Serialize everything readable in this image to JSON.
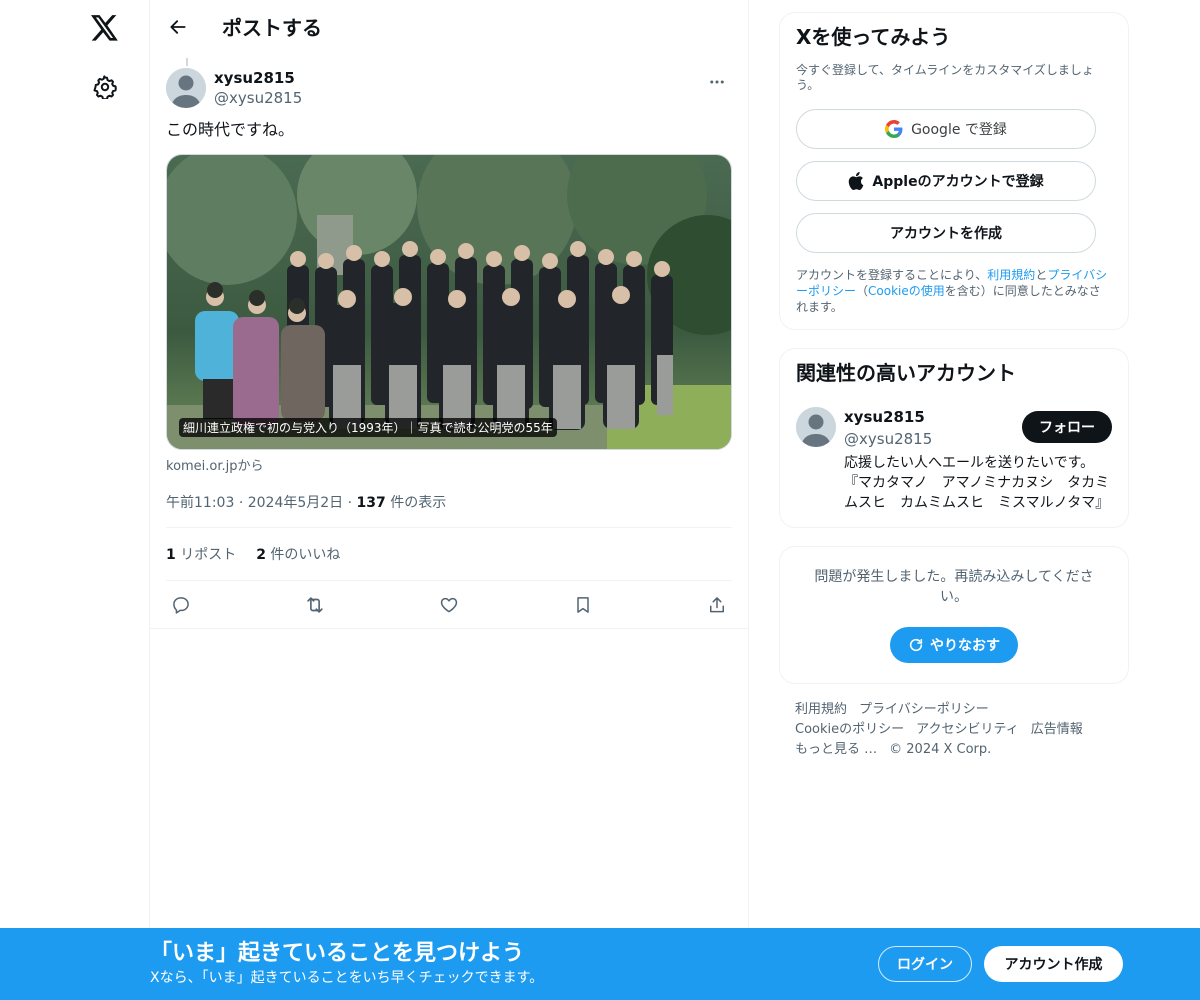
{
  "header": {
    "title": "ポストする"
  },
  "post": {
    "author_name": "xysu2815",
    "author_handle": "@xysu2815",
    "text": "この時代ですね。",
    "card_caption": "細川連立政権で初の与党入り（1993年）｜写真で読む公明党の55年",
    "card_source": "komei.or.jpから",
    "time": "午前11:03",
    "date": "2024年5月2日",
    "views_count": "137",
    "views_label": "件の表示",
    "reposts_count": "1",
    "reposts_label": "リポスト",
    "likes_count": "2",
    "likes_label": "件のいいね"
  },
  "signup": {
    "title": "Xを使ってみよう",
    "subtitle": "今すぐ登録して、タイムラインをカスタマイズしましょう。",
    "google_label": "Google で登録",
    "apple_label": "Appleのアカウントで登録",
    "create_label": "アカウントを作成",
    "legal_prefix": "アカウントを登録することにより、",
    "legal_terms": "利用規約",
    "legal_and": "と",
    "legal_privacy": "プライバシーポリシー",
    "legal_open": "（",
    "legal_cookie": "Cookieの使用",
    "legal_suffix": "を含む）に同意したとみなされます。"
  },
  "relevant": {
    "title": "関連性の高いアカウント",
    "name": "xysu2815",
    "handle": "@xysu2815",
    "bio": "応援したい人へエールを送りたいです。『マカタマノ　アマノミナカヌシ　タカミムスヒ　カムミムスヒ　ミスマルノタマ』",
    "follow_label": "フォロー"
  },
  "error": {
    "text": "問題が発生しました。再読み込みしてください。",
    "retry_label": "やりなおす"
  },
  "footer": {
    "terms": "利用規約",
    "privacy": "プライバシーポリシー",
    "cookie": "Cookieのポリシー",
    "accessibility": "アクセシビリティ",
    "ads": "広告情報",
    "more": "もっと見る …",
    "copyright": "© 2024 X Corp."
  },
  "banner": {
    "title": "「いま」起きていることを見つけよう",
    "subtitle": "Xなら、「いま」起きていることをいち早くチェックできます。",
    "login_label": "ログイン",
    "create_label": "アカウント作成"
  },
  "colors": {
    "accent": "#1d9bf0",
    "text": "#0f1419",
    "muted": "#536471",
    "border": "#eff3f4"
  }
}
